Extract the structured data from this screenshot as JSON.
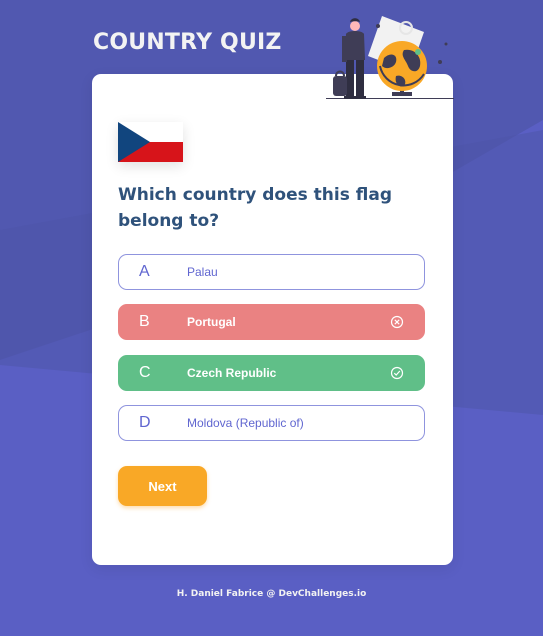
{
  "app": {
    "title": "COUNTRY QUIZ"
  },
  "quiz": {
    "question": "Which country does this flag belong to?",
    "flag_icon": "czech-republic-flag",
    "options": [
      {
        "letter": "A",
        "text": "Palau",
        "state": "default"
      },
      {
        "letter": "B",
        "text": "Portugal",
        "state": "wrong",
        "status_icon": "x-circle-icon"
      },
      {
        "letter": "C",
        "text": "Czech Republic",
        "state": "correct",
        "status_icon": "check-circle-icon"
      },
      {
        "letter": "D",
        "text": "Moldova (Republic of)",
        "state": "default"
      }
    ],
    "next_label": "Next"
  },
  "footer": {
    "credit": "H. Daniel Fabrice @ DevChallenges.io"
  },
  "colors": {
    "background": "#5a5fc4",
    "title": "#f3f3f3",
    "question": "#2f527b",
    "option_border": "#6066d0",
    "wrong": "#ea8282",
    "correct": "#60bf88",
    "next_button": "#f9a826"
  }
}
